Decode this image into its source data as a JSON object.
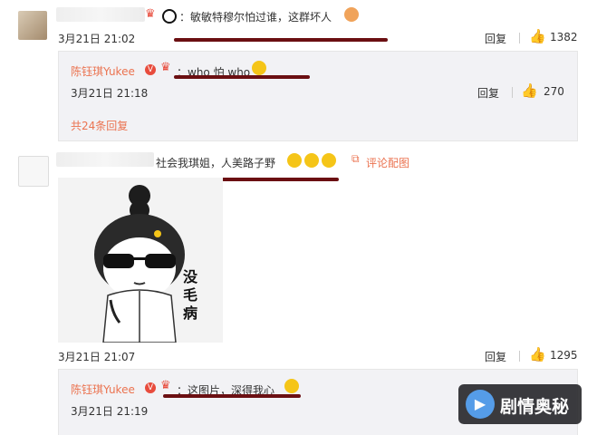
{
  "comment1": {
    "text": "：敏敏特穆尔怕过谁，这群坏人",
    "time": "3月21日 21:02",
    "reply_label": "回复",
    "like_count": "1382",
    "reply": {
      "author": "陈钰琪Yukee",
      "text": "：who 怕 who",
      "time": "3月21日 21:18",
      "reply_label": "回复",
      "like_count": "270"
    },
    "more_replies": "共24条回复"
  },
  "comment2": {
    "text": "社会我琪姐，人美路子野",
    "comment_image_link": "评论配图",
    "image_caption": "没毛病",
    "time": "3月21日 21:07",
    "reply_label": "回复",
    "like_count": "1295",
    "reply": {
      "author": "陈钰琪Yukee",
      "text": "：这图片，深得我心",
      "time": "3月21日 21:19"
    }
  },
  "watermark": {
    "text": "剧情奥秘"
  },
  "colors": {
    "name": "#eb7350",
    "underline": "#6b0f12",
    "reply_bg": "#f2f2f5"
  }
}
